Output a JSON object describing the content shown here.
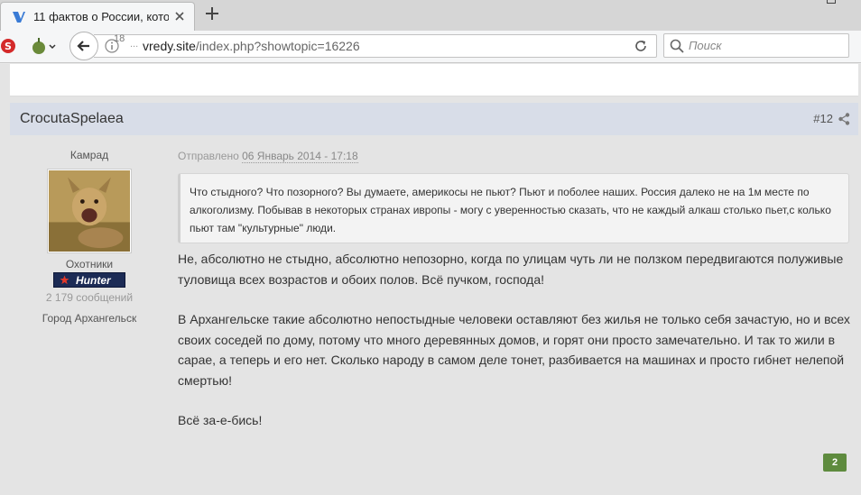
{
  "browser": {
    "tab": {
      "title": "11 фактов о России, кото…"
    },
    "address": {
      "domain": "vredy.site",
      "path": "/index.php?showtopic=16226",
      "badge": "18",
      "dots": "..."
    },
    "search": {
      "placeholder": "Поиск"
    }
  },
  "post": {
    "author": "CrocutaSpelaea",
    "number": "#12",
    "rank": "Камрад",
    "group": "Охотники",
    "badge_label": "Hunter",
    "post_count": "2 179 сообщений",
    "city": "Город Архангельск",
    "date_prefix": "Отправлено",
    "date": "06 Январь 2014 - 17:18",
    "quote": "Что стыдного? Что позорного? Вы думаете, америкосы не пьют? Пьют и поболее наших. Россия далеко не на 1м месте по алкоголизму. Побывав в некоторых странах ивропы - могу с уверенностью сказать, что не каждый алкаш столько пьет,с колько пьют там \"культурные\" люди.",
    "paragraphs": [
      "Не, абсолютно не стыдно, абсолютно непозорно, когда по улицам чуть ли не ползком передвигаются полуживые туловища всех возрастов и обоих полов. Всё пучком, господа!",
      "В Архангельске такие абсолютно непостыдные человеки оставляют без жилья не только себя зачастую, но и всех своих соседей по дому, потому что много деревянных домов, и горят они просто замечательно. И так то жили в сарае, а теперь и его нет. Сколько народу в самом деле тонет, разбивается на машинах и просто гибнет нелепой смертью!",
      "Всё за-е-бись!"
    ],
    "reputation": "2"
  },
  "colors": {
    "header_bg": "#d8dde8",
    "badge_bg": "#1c2b55",
    "rep_bg": "#5e8b3e"
  }
}
